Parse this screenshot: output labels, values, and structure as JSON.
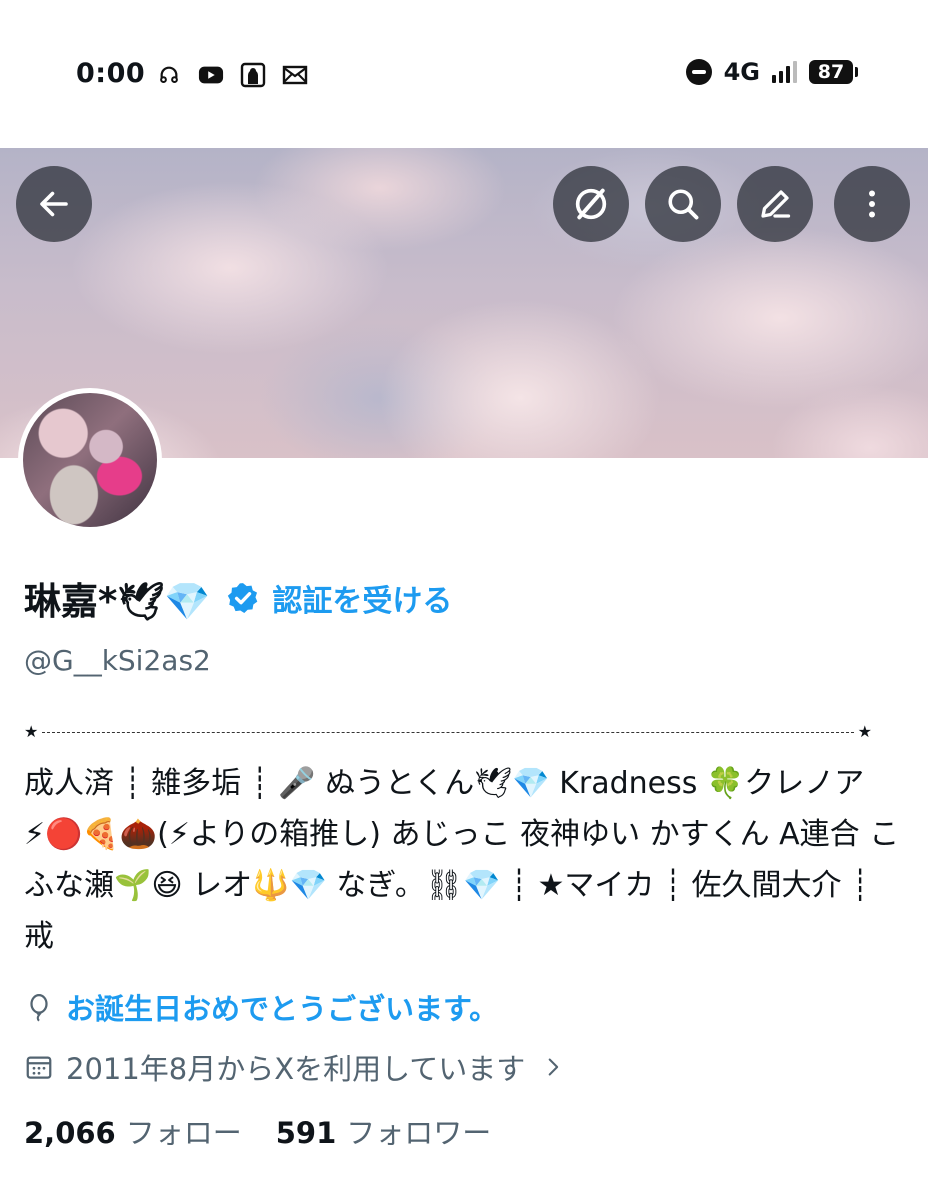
{
  "status_bar": {
    "time": "0:00",
    "network": "4G",
    "battery": "87",
    "left_icons": [
      "headphones-icon",
      "youtube-icon",
      "app-icon",
      "mail-icon"
    ]
  },
  "header": {
    "buttons": [
      "back-arrow-icon",
      "grok-icon",
      "search-icon",
      "edit-icon",
      "more-vertical-icon"
    ]
  },
  "profile": {
    "name": "琳嘉*🕊💎",
    "verify_link": "認証を受ける",
    "handle": "@G__kSi2as2",
    "bio": "成人済 ┊ 雑多垢 ┊ 🎤 ぬうとくん🕊💎 Kradness 🍀クレノア⚡🔴🍕🌰(⚡よりの箱推し) あじっこ 夜神ゆい かすくん A連合 こふな瀬🌱😆 レオ🔱💎 なぎ。⛓💎 ┊ ★マイカ ┊ 佐久間大介 ┊ 戒",
    "birthday_text": "お誕生日おめでとうございます。",
    "joined_text": "2011年8月からXを利用しています",
    "following_count": "2,066",
    "following_label": "フォロー",
    "followers_count": "591",
    "followers_label": "フォロワー"
  },
  "colors": {
    "accent": "#1d9bf0",
    "secondary_text": "#536471",
    "primary_text": "#0f1419"
  }
}
